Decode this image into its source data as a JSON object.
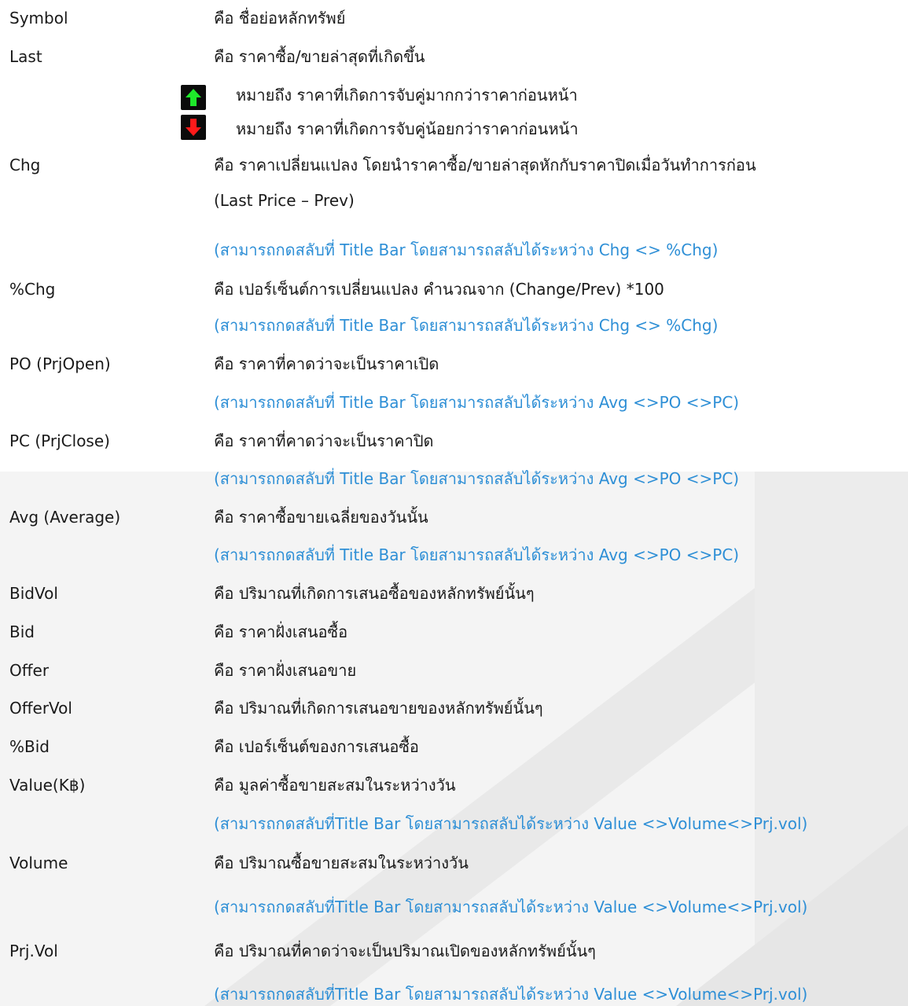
{
  "colors": {
    "text": "#1a1a1a",
    "note": "#2e8fd6",
    "up_arrow": "#1ee82a",
    "down_arrow": "#ff1a1a",
    "watermark": "#eeeeee"
  },
  "icons": {
    "up": "green-up-arrow-icon",
    "down": "red-down-arrow-icon"
  },
  "rows": [
    {
      "term": "Symbol",
      "desc": "คือ ชื่อย่อหลักทรัพย์"
    },
    {
      "term": "Last",
      "desc": "คือ ราคาซื้อ/ขายล่าสุดที่เกิดขึ้น"
    },
    {
      "legend_up": "หมายถึง ราคาที่เกิดการจับคู่มากกว่าราคาก่อนหน้า"
    },
    {
      "legend_down": "หมายถึง ราคาที่เกิดการจับคู่น้อยกว่าราคาก่อนหน้า"
    },
    {
      "term": "Chg",
      "desc": "คือ ราคาเปลี่ยนแปลง โดยนำราคาซื้อ/ขายล่าสุดหักกับราคาปิดเมื่อวันทำการก่อน"
    },
    {
      "desc": "(Last Price – Prev)"
    },
    {
      "note": "(สามารถกดสลับที่ Title Bar โดยสามารถสลับได้ระหว่าง Chg <> %Chg)"
    },
    {
      "term": "%Chg",
      "desc": "คือ เปอร์เซ็นต์การเปลี่ยนแปลง คำนวณจาก (Change/Prev) *100"
    },
    {
      "note": "(สามารถกดสลับที่ Title Bar โดยสามารถสลับได้ระหว่าง Chg <> %Chg)"
    },
    {
      "term": "PO (PrjOpen)",
      "desc": "คือ ราคาที่คาดว่าจะเป็นราคาเปิด"
    },
    {
      "note": "(สามารถกดสลับที่ Title Bar โดยสามารถสลับได้ระหว่าง Avg <>PO <>PC)"
    },
    {
      "term": "PC (PrjClose)",
      "desc": "คือ ราคาที่คาดว่าจะเป็นราคาปิด"
    },
    {
      "note": "(สามารถกดสลับที่ Title Bar โดยสามารถสลับได้ระหว่าง Avg <>PO <>PC)"
    },
    {
      "term": "Avg (Average)",
      "desc": "คือ ราคาซื้อขายเฉลี่ยของวันนั้น"
    },
    {
      "note": "(สามารถกดสลับที่ Title Bar โดยสามารถสลับได้ระหว่าง Avg <>PO <>PC)"
    },
    {
      "term": "BidVol",
      "desc": "คือ ปริมาณที่เกิดการเสนอซื้อของหลักทรัพย์นั้นๆ"
    },
    {
      "term": "Bid",
      "desc": "คือ ราคาฝั่งเสนอซื้อ"
    },
    {
      "term": "Offer",
      "desc": "คือ ราคาฝั่งเสนอขาย"
    },
    {
      "term": "OfferVol",
      "desc": "คือ ปริมาณที่เกิดการเสนอขายของหลักทรัพย์นั้นๆ"
    },
    {
      "term": "%Bid",
      "desc": "คือ เปอร์เซ็นต์ของการเสนอซื้อ"
    },
    {
      "term": "Value(K฿)",
      "desc": "คือ มูลค่าซื้อขายสะสมในระหว่างวัน"
    },
    {
      "note": "(สามารถกดสลับที่Title Bar โดยสามารถสลับได้ระหว่าง Value <>Volume<>Prj.vol)"
    },
    {
      "term": "Volume",
      "desc": "คือ ปริมาณซื้อขายสะสมในระหว่างวัน"
    },
    {
      "note": "(สามารถกดสลับที่Title Bar โดยสามารถสลับได้ระหว่าง Value <>Volume<>Prj.vol)"
    },
    {
      "term": "Prj.Vol",
      "desc": "คือ ปริมาณที่คาดว่าจะเป็นปริมาณเปิดของหลักทรัพย์นั้นๆ"
    },
    {
      "note": "(สามารถกดสลับที่Title Bar โดยสามารถสลับได้ระหว่าง Value <>Volume<>Prj.vol)"
    }
  ]
}
